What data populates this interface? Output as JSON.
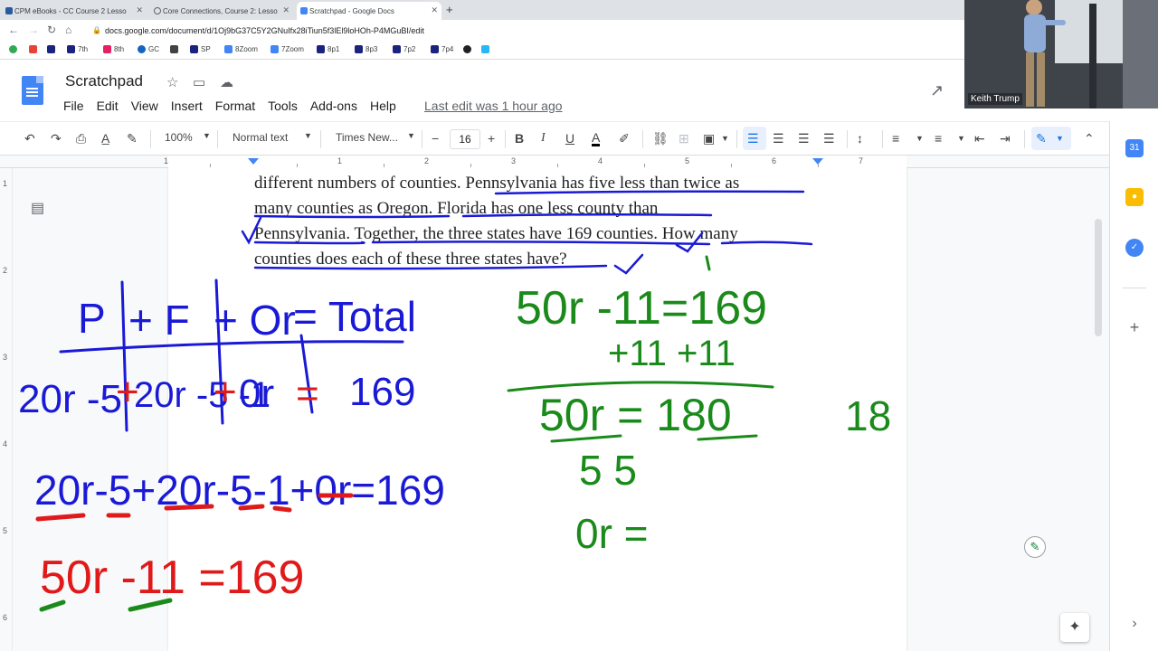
{
  "browser": {
    "tabs": [
      {
        "title": "CPM eBooks - CC Course 2 Lesso",
        "active": false,
        "color": "#5f6368"
      },
      {
        "title": "Core Connections, Course 2: Lesso",
        "active": false,
        "color": "#5f6368"
      },
      {
        "title": "Scratchpad - Google Docs",
        "active": true,
        "color": "#4285f4"
      }
    ],
    "url": "docs.google.com/document/d/1Oj9bG37C5Y2GNuIfx28iTiun5f3lEl9loHOh-P4MGuBI/edit",
    "bookmarks": [
      "7th",
      "8th",
      "GC",
      "SP",
      "8Zoom",
      "7Zoom",
      "8p1",
      "8p3",
      "7p2",
      "7p4"
    ]
  },
  "docs": {
    "title": "Scratchpad",
    "menus": [
      "File",
      "Edit",
      "View",
      "Insert",
      "Format",
      "Tools",
      "Add-ons",
      "Help"
    ],
    "last_edit": "Last edit was 1 hour ago"
  },
  "toolbar": {
    "zoom": "100%",
    "style": "Normal text",
    "font": "Times New...",
    "font_size": "16"
  },
  "ruler": {
    "numbers": [
      "1",
      "1",
      "2",
      "3",
      "4",
      "5",
      "6",
      "7"
    ]
  },
  "vertical_ruler": {
    "numbers": [
      "1",
      "2",
      "3",
      "4",
      "5",
      "6"
    ]
  },
  "document": {
    "lines": [
      "different numbers of counties.  Pennsylvania has five less than twice as",
      "many counties as Oregon.  Florida has one less county than",
      "Pennsylvania.  Together, the three states have 169 counties.  How many",
      "counties does each of these three states have?"
    ]
  },
  "ink": {
    "colors": {
      "blue": "#1a1ad6",
      "red": "#e01a1a",
      "green": "#1a8a1a"
    },
    "table_headers": [
      "P",
      "+ F",
      "+ Or",
      "= Total"
    ],
    "row1": [
      "20r -5",
      "+",
      "20r -5 -1",
      "+",
      "0r",
      "=",
      "169"
    ],
    "eq2": "20r-5+20r-5-1+0r=169",
    "eq3": "50r -11 =169",
    "work": [
      "50r -11=169",
      "+11  +11",
      "50r = 180",
      "5        5",
      "0r =",
      "18"
    ]
  },
  "webcam": {
    "name": "Keith Trump"
  }
}
